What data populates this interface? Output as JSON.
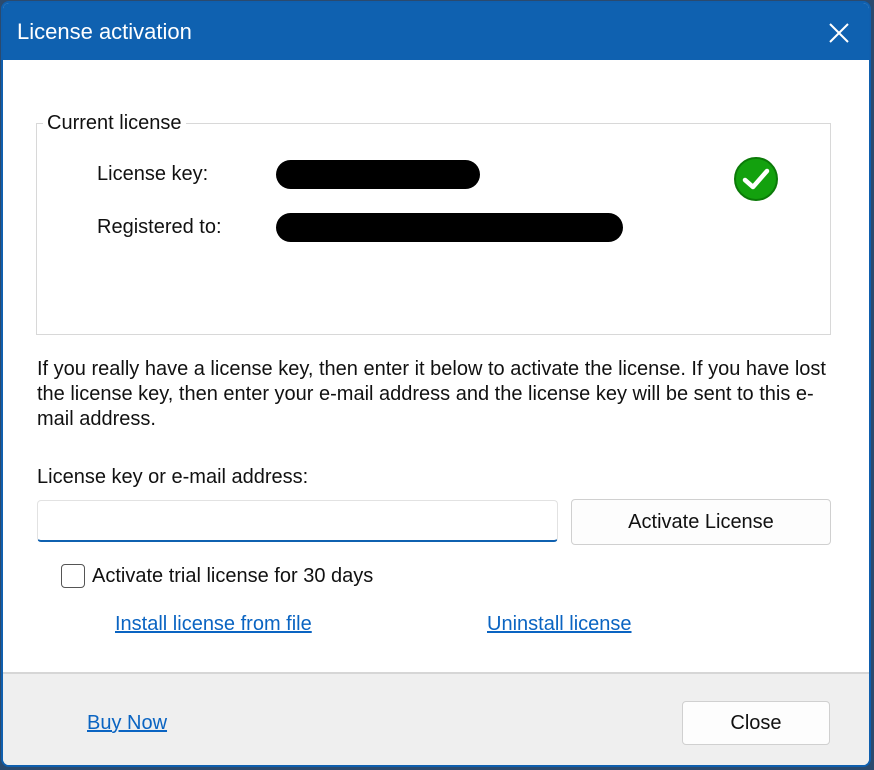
{
  "window": {
    "title": "License activation",
    "close_icon": "close-icon"
  },
  "current_license": {
    "legend": "Current license",
    "license_key_label": "License key:",
    "registered_to_label": "Registered to:",
    "status_icon": "check-circle-icon",
    "status_color": "#13a10e"
  },
  "info_text": "If you really have a license key, then enter it below to activate the license. If you have lost the license key, then enter your e-mail address and the license key will be sent to this e-mail address.",
  "input": {
    "label": "License key or e-mail address:",
    "value": "",
    "placeholder": ""
  },
  "activate_button": "Activate License",
  "trial_checkbox": {
    "label": "Activate trial license for 30 days",
    "checked": false
  },
  "links": {
    "install": "Install license from file",
    "uninstall": "Uninstall license"
  },
  "footer": {
    "buy_now": "Buy Now",
    "close": "Close"
  },
  "colors": {
    "titlebar": "#0f61b0",
    "link": "#0a64c2",
    "accent": "#0f61b0"
  }
}
